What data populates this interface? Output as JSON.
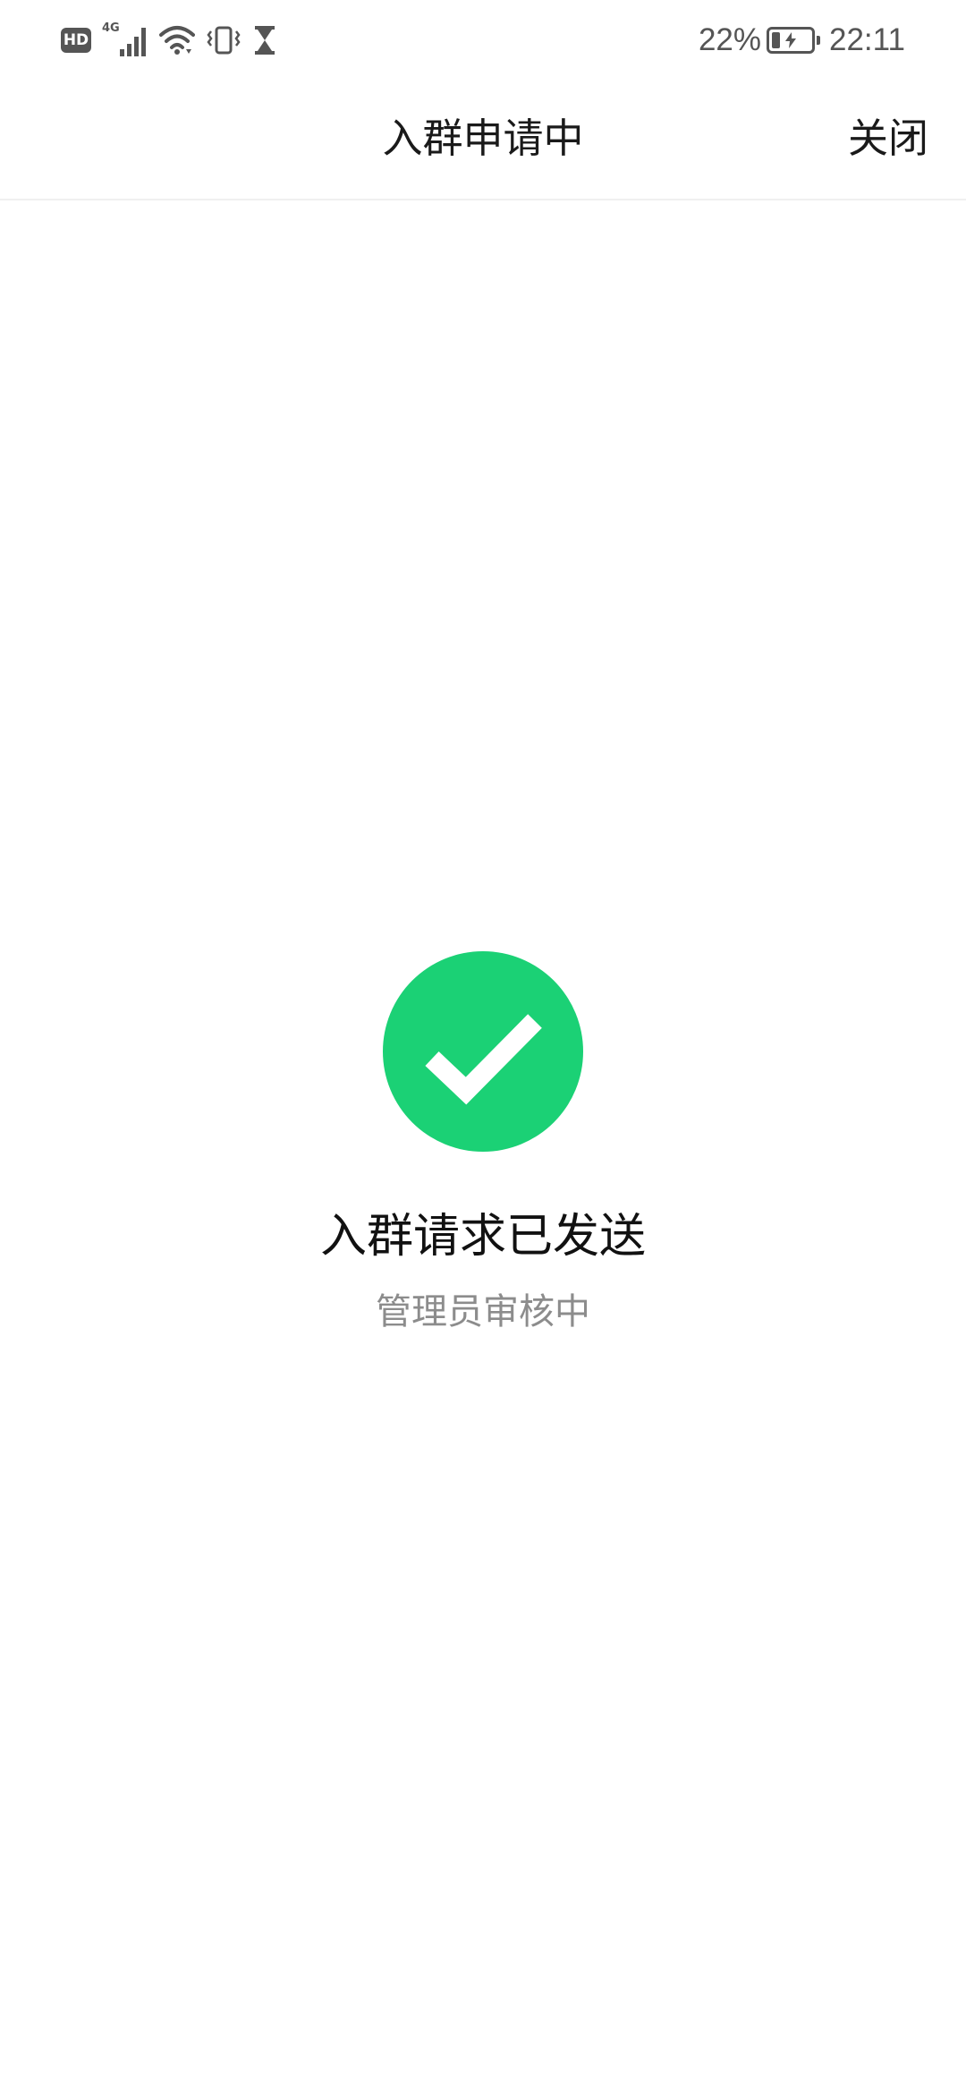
{
  "status_bar": {
    "hd_label": "HD",
    "network_label": "4G",
    "battery_percent": "22%",
    "battery_level": 0.22,
    "time": "22:11",
    "icons": [
      "hd-icon",
      "signal-4g-icon",
      "wifi-icon",
      "vibrate-icon",
      "hourglass-icon",
      "battery-charging-icon"
    ]
  },
  "nav": {
    "title": "入群申请中",
    "close_label": "关闭"
  },
  "result": {
    "icon": "success-check-icon",
    "title": "入群请求已发送",
    "subtitle": "管理员审核中"
  },
  "colors": {
    "success_green": "#1bd175",
    "title_text": "#111111",
    "subtitle_text": "#8c8c8c",
    "status_icons": "#555555"
  }
}
